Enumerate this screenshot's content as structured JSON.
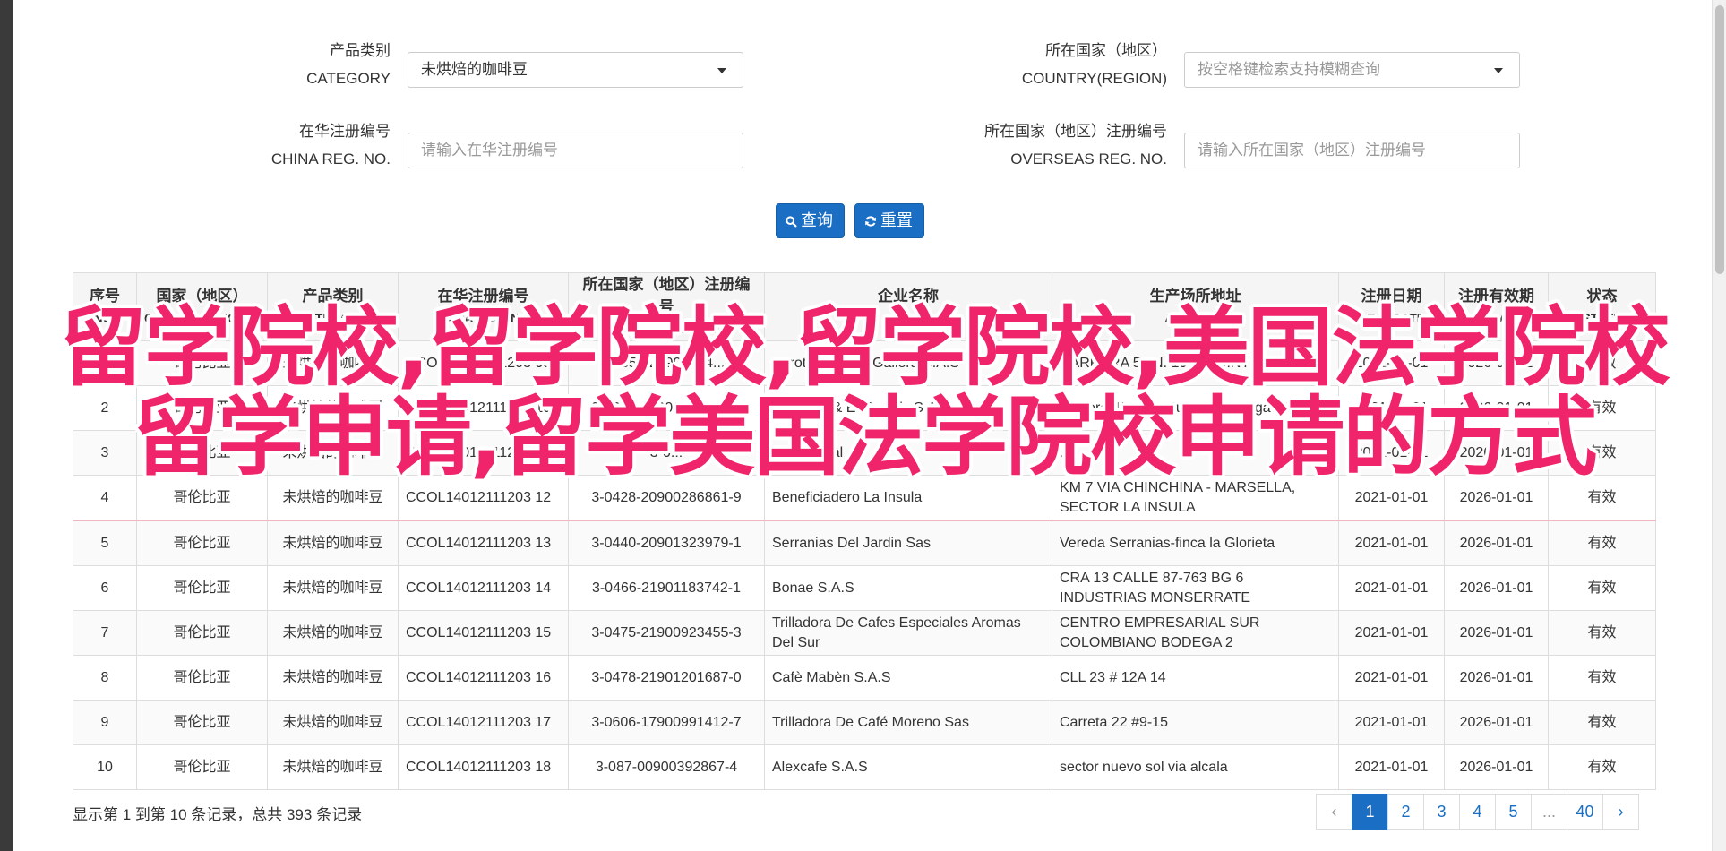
{
  "search": {
    "category_label_cn": "产品类别",
    "category_label_en": "CATEGORY",
    "category_value": "未烘焙的咖啡豆",
    "country_label_cn": "所在国家（地区）",
    "country_label_en": "COUNTRY(REGION)",
    "country_placeholder": "按空格键检索支持模糊查询",
    "china_reg_label_cn": "在华注册编号",
    "china_reg_label_en": "CHINA REG. NO.",
    "china_reg_placeholder": "请输入在华注册编号",
    "overseas_reg_label_cn": "所在国家（地区）注册编号",
    "overseas_reg_label_en": "OVERSEAS REG. NO.",
    "overseas_reg_placeholder": "请输入所在国家（地区）注册编号",
    "query_button": "查询",
    "reset_button": "重置"
  },
  "table": {
    "headers": [
      {
        "cn": "序号",
        "en": "NO."
      },
      {
        "cn": "国家（地区）",
        "en": "COUNTRY(REGIO..."
      },
      {
        "cn": "产品类别",
        "en": "CATEGORY"
      },
      {
        "cn": "在华注册编号",
        "en": "CHINA REG. NO."
      },
      {
        "cn": "所在国家（地区）注册编号",
        "en": "OVERSEAS REG. NO."
      },
      {
        "cn": "企业名称",
        "en": "NAME"
      },
      {
        "cn": "生产场所地址",
        "en": "ADDRESS"
      },
      {
        "cn": "注册日期",
        "en": "REG. DATE"
      },
      {
        "cn": "注册有效期",
        "en": "REG. DATE ..."
      },
      {
        "cn": "状态",
        "en": "STATE"
      }
    ],
    "rows": [
      [
        "1",
        "哥伦比亚",
        "未烘焙的咖啡豆",
        "CCOL14012111203 09",
        "3-0351-20900484...1",
        "Agrotienda Las Gallera S.A.S",
        "CARRERA 50 N. 10-118 ...NTE NIQUIA",
        "2021-01-01",
        "2026-01-01",
        "有效"
      ],
      [
        "2",
        "哥伦比亚",
        "未烘焙的咖啡豆",
        "CCOL14012111203 10",
        "3-0383-19000586973-0",
        "Bonbons & El Francis S.A.S",
        "Carrera 49 N 61 Sur-540 Bodega 10",
        "2021-01-01",
        "2026-01-01",
        "有效"
      ],
      [
        "3",
        "哥伦比亚",
        "未烘焙的咖啡豆",
        "CCOL14012111203 11",
        "3-0...",
        "Cafe Royal",
        "...",
        "2021-01-01",
        "2026-01-01",
        "有效"
      ],
      [
        "4",
        "哥伦比亚",
        "未烘焙的咖啡豆",
        "CCOL14012111203 12",
        "3-0428-20900286861-9",
        "Beneficiadero La Insula",
        "KM 7 VIA CHINCHINA - MARSELLA, SECTOR LA INSULA",
        "2021-01-01",
        "2026-01-01",
        "有效"
      ],
      [
        "5",
        "哥伦比亚",
        "未烘焙的咖啡豆",
        "CCOL14012111203 13",
        "3-0440-20901323979-1",
        "Serranias Del Jardin Sas",
        "Vereda Serranias-finca la Glorieta",
        "2021-01-01",
        "2026-01-01",
        "有效"
      ],
      [
        "6",
        "哥伦比亚",
        "未烘焙的咖啡豆",
        "CCOL14012111203 14",
        "3-0466-21901183742-1",
        "Bonae S.A.S",
        "CRA 13 CALLE 87-763 BG 6 INDUSTRIAS MONSERRATE",
        "2021-01-01",
        "2026-01-01",
        "有效"
      ],
      [
        "7",
        "哥伦比亚",
        "未烘焙的咖啡豆",
        "CCOL14012111203 15",
        "3-0475-21900923455-3",
        "Trilladora De Cafes Especiales Aromas Del Sur",
        "CENTRO EMPRESARIAL SUR COLOMBIANO BODEGA 2",
        "2021-01-01",
        "2026-01-01",
        "有效"
      ],
      [
        "8",
        "哥伦比亚",
        "未烘焙的咖啡豆",
        "CCOL14012111203 16",
        "3-0478-21901201687-0",
        "Cafè Mabèn S.A.S",
        "CLL 23 # 12A 14",
        "2021-01-01",
        "2026-01-01",
        "有效"
      ],
      [
        "9",
        "哥伦比亚",
        "未烘焙的咖啡豆",
        "CCOL14012111203 17",
        "3-0606-17900991412-7",
        "Trilladora De Café Moreno Sas",
        "Carreta 22 #9-15",
        "2021-01-01",
        "2026-01-01",
        "有效"
      ],
      [
        "10",
        "哥伦比亚",
        "未烘焙的咖啡豆",
        "CCOL14012111203 18",
        "3-087-00900392867-4",
        "Alexcafe S.A.S",
        "sector nuevo sol via alcala",
        "2021-01-01",
        "2026-01-01",
        "有效"
      ]
    ]
  },
  "summary": "显示第 1 到第 10 条记录，总共 393 条记录",
  "pagination": [
    "‹",
    "1",
    "2",
    "3",
    "4",
    "5",
    "...",
    "40",
    "›"
  ],
  "overlay_title": "留学院校,留学院校,留学院校,美国法学院校留学申请,留学美国法学院校申请的方式",
  "colors": {
    "accent": "#1a6fc4",
    "overlay": "#f0246a"
  }
}
